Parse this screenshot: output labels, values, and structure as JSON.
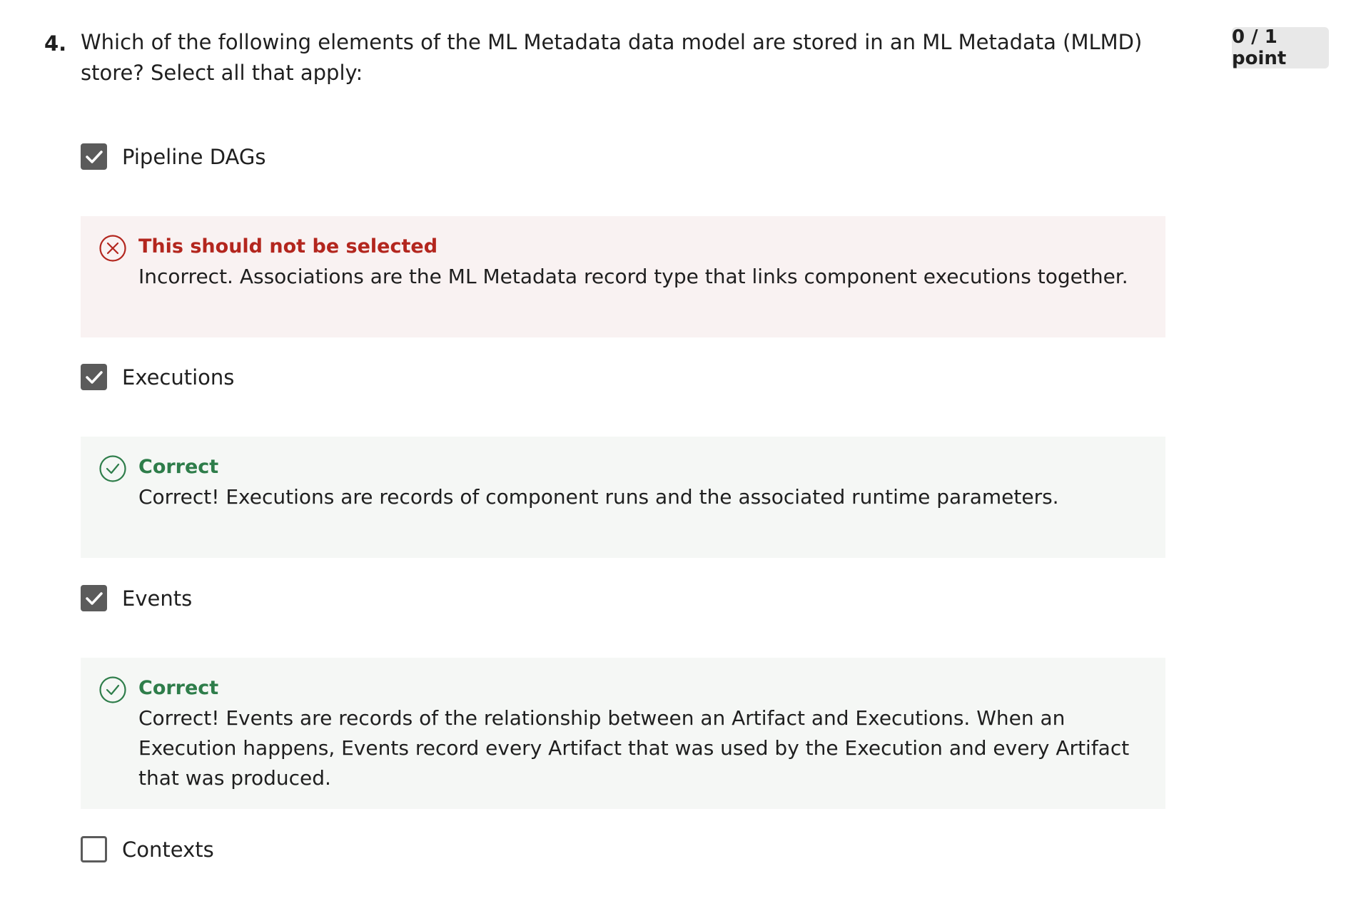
{
  "question": {
    "number": "4.",
    "text": "Which of the following elements of the ML Metadata data model are stored in an ML Metadata (MLMD) store? Select all that apply:",
    "score": "0 / 1 point"
  },
  "options": [
    {
      "label": "Pipeline DAGs",
      "checked": true,
      "feedback": {
        "status": "incorrect",
        "title": "This should not be selected",
        "body": "Incorrect. Associations are the ML Metadata record type that links component executions together."
      }
    },
    {
      "label": "Executions",
      "checked": true,
      "feedback": {
        "status": "correct",
        "title": "Correct",
        "body": "Correct! Executions are records of component runs and the associated runtime parameters."
      }
    },
    {
      "label": "Events",
      "checked": true,
      "feedback": {
        "status": "correct",
        "title": "Correct",
        "body": "Correct! Events are records of the relationship between an Artifact and Executions. When an Execution happens, Events record every Artifact that was used by the Execution and every Artifact that was produced."
      }
    },
    {
      "label": "Contexts",
      "checked": false
    }
  ],
  "colors": {
    "incorrect": "#b3261e",
    "correct": "#2e7d4a",
    "checkbox": "#5b5b5b"
  },
  "icons": {
    "checked": "checkmark-icon",
    "incorrect": "x-circle-icon",
    "correct": "check-circle-icon"
  }
}
